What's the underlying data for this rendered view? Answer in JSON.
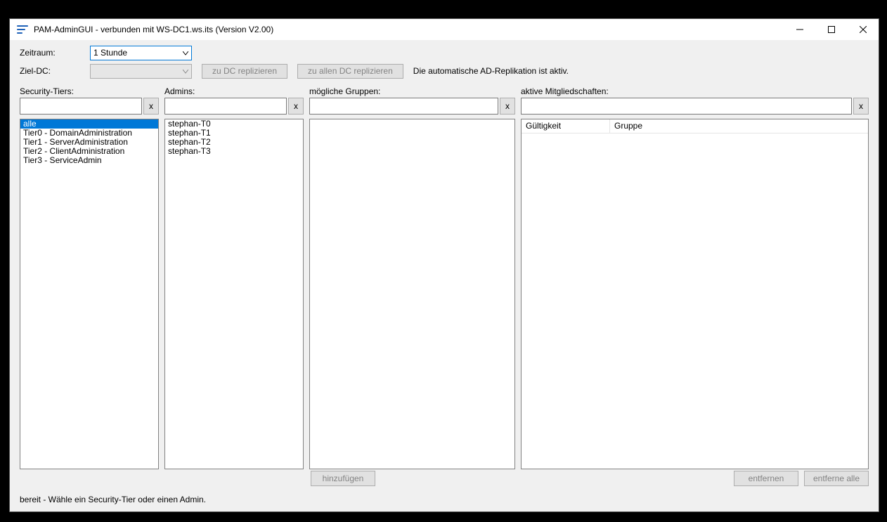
{
  "titlebar": {
    "title": "PAM-AdminGUI - verbunden mit WS-DC1.ws.its (Version V2.00)"
  },
  "form": {
    "zeitraum_label": "Zeitraum:",
    "zeitraum_value": "1 Stunde",
    "zieldc_label": "Ziel-DC:",
    "zieldc_value": "",
    "btn_replicate_dc": "zu DC replizieren",
    "btn_replicate_all": "zu allen DC replizieren",
    "info": "Die automatische AD-Replikation ist aktiv."
  },
  "headers": {
    "tiers": "Security-Tiers:",
    "admins": "Admins:",
    "groups": "mögliche Gruppen:",
    "memberships": "aktive Mitgliedschaften:"
  },
  "filters": {
    "clear": "x"
  },
  "tiers": {
    "items": {
      "0": "alle",
      "1": "Tier0 - DomainAdministration",
      "2": "Tier1 - ServerAdministration",
      "3": "Tier2 - ClientAdministration",
      "4": "Tier3 - ServiceAdmin"
    }
  },
  "admins": {
    "items": {
      "0": "stephan-T0",
      "1": "stephan-T1",
      "2": "stephan-T2",
      "3": "stephan-T3"
    }
  },
  "memberships_grid": {
    "col_validity": "Gültigkeit",
    "col_group": "Gruppe"
  },
  "actions": {
    "add": "hinzufügen",
    "remove": "entfernen",
    "remove_all": "entferne alle"
  },
  "status": "bereit - Wähle ein Security-Tier oder einen Admin."
}
